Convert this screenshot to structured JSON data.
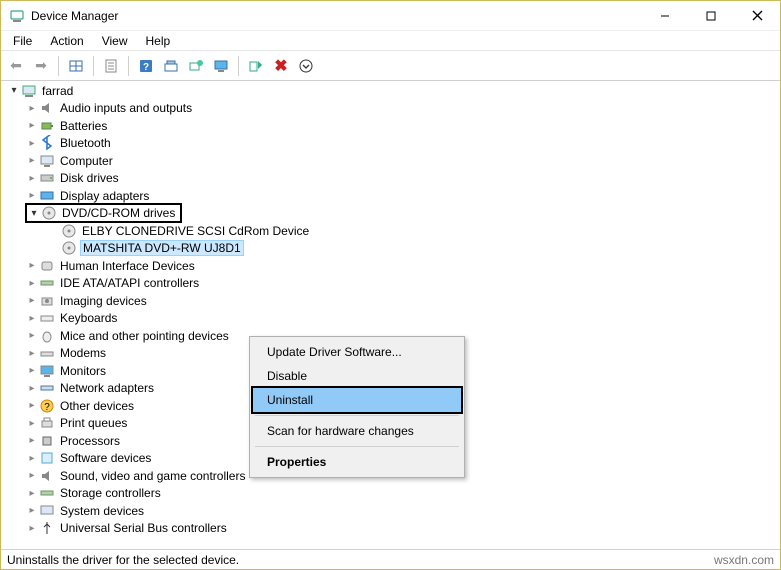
{
  "window": {
    "title": "Device Manager"
  },
  "menus": {
    "file": "File",
    "action": "Action",
    "view": "View",
    "help": "Help"
  },
  "tree": {
    "root": "farrad",
    "items": [
      "Audio inputs and outputs",
      "Batteries",
      "Bluetooth",
      "Computer",
      "Disk drives",
      "Display adapters"
    ],
    "dvd": {
      "label": "DVD/CD-ROM drives",
      "children": [
        "ELBY CLONEDRIVE SCSI CdRom Device",
        "MATSHITA DVD+-RW UJ8D1"
      ]
    },
    "rest": [
      "Human Interface Devices",
      "IDE ATA/ATAPI controllers",
      "Imaging devices",
      "Keyboards",
      "Mice and other pointing devices",
      "Modems",
      "Monitors",
      "Network adapters",
      "Other devices",
      "Print queues",
      "Processors",
      "Software devices",
      "Sound, video and game controllers",
      "Storage controllers",
      "System devices",
      "Universal Serial Bus controllers"
    ]
  },
  "context_menu": {
    "update": "Update Driver Software...",
    "disable": "Disable",
    "uninstall": "Uninstall",
    "scan": "Scan for hardware changes",
    "properties": "Properties"
  },
  "status": {
    "text": "Uninstalls the driver for the selected device.",
    "watermark": "wsxdn.com"
  }
}
